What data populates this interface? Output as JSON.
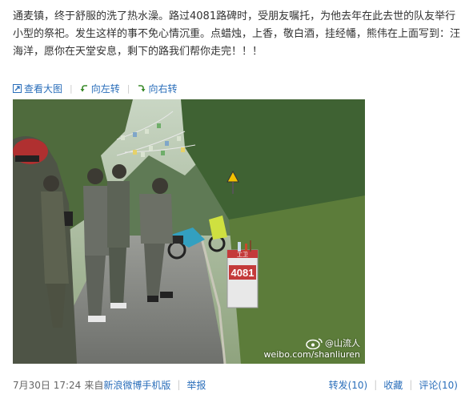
{
  "post": {
    "text": "通麦镇，终于舒服的洗了热水澡。路过4081路碑时，受朋友嘱托，为他去年在此去世的队友举行小型的祭祀。发生这样的事不免心情沉重。点蜡烛，上香，敬白酒，挂经幡，熊伟在上面写到：汪海洋，愿你在天堂安息，剩下的路我们帮你走完！！！"
  },
  "media_actions": {
    "view_large": "查看大图",
    "rotate_left": "向左转",
    "rotate_right": "向右转",
    "separator": "|"
  },
  "photo": {
    "milestone_number": "4081",
    "milestone_top": "工卫",
    "watermark_handle": "@山流人",
    "watermark_url": "weibo.com/shanliuren"
  },
  "meta": {
    "time": "7月30日 17:24",
    "from_label": "来自",
    "source": "新浪微博手机版",
    "separator": "|",
    "report": "举报",
    "repost": "转发(10)",
    "favorite": "收藏",
    "comment": "评论(10)"
  },
  "colors": {
    "link": "#2a6eba",
    "text": "#333333",
    "muted": "#666666",
    "separator": "#cccccc"
  }
}
